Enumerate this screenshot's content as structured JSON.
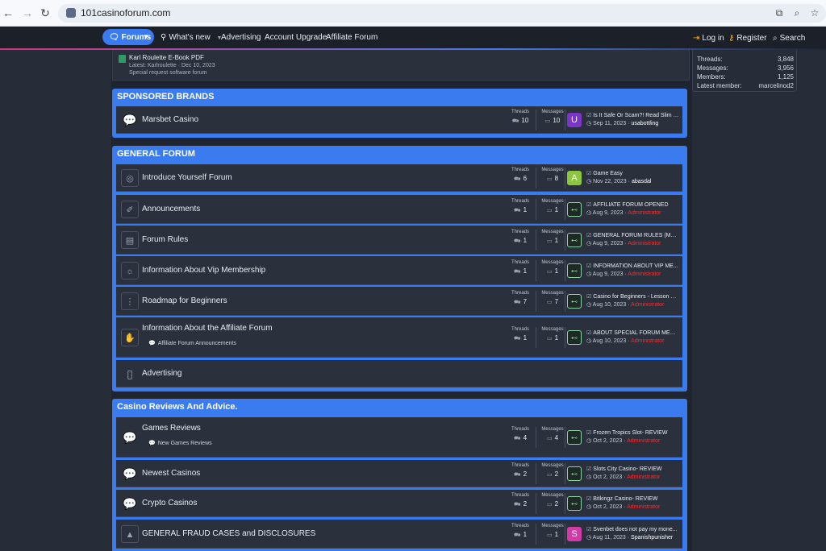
{
  "browser": {
    "url": "101casinoforum.com"
  },
  "nav": {
    "forums": "Forums",
    "whats_new": "What's new",
    "advertising": "Advertising",
    "account_upgrade": "Account Upgrade",
    "affiliate_forum": "Affiliate Forum",
    "login": "Log in",
    "register": "Register",
    "search": "Search"
  },
  "stats": {
    "threads_label": "Threads:",
    "threads": "3,848",
    "messages_label": "Messages:",
    "messages": "3,956",
    "members_label": "Members:",
    "members": "1,125",
    "latest_label": "Latest member:",
    "latest": "marcelinod2"
  },
  "prev_node": {
    "title": "Karl Roulette E-Book PDF",
    "latest": "Latest: Karlroulette · Dec 10, 2023",
    "section": "Special request software forum"
  },
  "labels": {
    "threads": "Threads",
    "messages": "Messages"
  },
  "categories": [
    {
      "title": "SPONSORED BRANDS",
      "nodes": [
        {
          "title": "Marsbet Casino",
          "threads": "10",
          "messages": "10",
          "avatar": "U",
          "last_title": "Is It Safe Or Scam?! Read Slim Li...",
          "last_date": "Sep 11, 2023",
          "last_user": "usabottling"
        }
      ]
    },
    {
      "title": "GENERAL FORUM",
      "nodes": [
        {
          "title": "Introduce Yourself Forum",
          "threads": "6",
          "messages": "8",
          "avatar": "A",
          "last_title": "Game Easy",
          "last_date": "Nov 22, 2023",
          "last_user": "abasdal"
        },
        {
          "title": "Announcements",
          "threads": "1",
          "messages": "1",
          "last_title": "AFFILIATE FORUM OPENED",
          "last_date": "Aug 9, 2023",
          "last_user": "Administrator"
        },
        {
          "title": "Forum Rules",
          "threads": "1",
          "messages": "1",
          "last_title": "GENERAL FORUM RULES (MUST...",
          "last_date": "Aug 9, 2023",
          "last_user": "Administrator"
        },
        {
          "title": "Information About Vip Membership",
          "threads": "1",
          "messages": "1",
          "last_title": "INFORMATION ABOUT VIP ME...",
          "last_date": "Aug 9, 2023",
          "last_user": "Administrator"
        },
        {
          "title": "Roadmap for Beginners",
          "threads": "7",
          "messages": "7",
          "last_title": "Casino for Beginners - Lesson 6 ...",
          "last_date": "Aug 10, 2023",
          "last_user": "Administrator"
        },
        {
          "title": "Information About the Affiliate Forum",
          "sub": "Affiliate Forum Announcements",
          "threads": "1",
          "messages": "1",
          "last_title": "ABOUT SPECIAL FORUM MEMB...",
          "last_date": "Aug 10, 2023",
          "last_user": "Administrator"
        },
        {
          "title": "Advertising"
        }
      ]
    },
    {
      "title": "Casino Reviews And Advice.",
      "nodes": [
        {
          "title": "Games Reviews",
          "sub": "New Games Reviews",
          "threads": "4",
          "messages": "4",
          "last_title": "Frozen Tropics Slot- REVIEW",
          "last_date": "Oct 2, 2023",
          "last_user": "Administrator"
        },
        {
          "title": "Newest Casinos",
          "threads": "2",
          "messages": "2",
          "last_title": "Slots City Casino- REVIEW",
          "last_date": "Oct 2, 2023",
          "last_user": "Administrator"
        },
        {
          "title": "Crypto Casinos",
          "threads": "2",
          "messages": "2",
          "last_title": "Bitkingz Casino- REVIEW",
          "last_date": "Oct 2, 2023",
          "last_user": "Administrator"
        },
        {
          "title": "GENERAL FRAUD CASES and DISCLOSURES",
          "threads": "1",
          "messages": "1",
          "avatar": "S",
          "last_title": "Svenbet does not pay my mone...",
          "last_date": "Aug 11, 2023",
          "last_user": "Spanishpunisher"
        }
      ]
    }
  ],
  "colors": {
    "accent": "#3b7bf0",
    "admin": "#ff2b2b",
    "avatar_u": "#7b35c9",
    "avatar_a": "#8cc63f",
    "avatar_s": "#d23aa8"
  }
}
